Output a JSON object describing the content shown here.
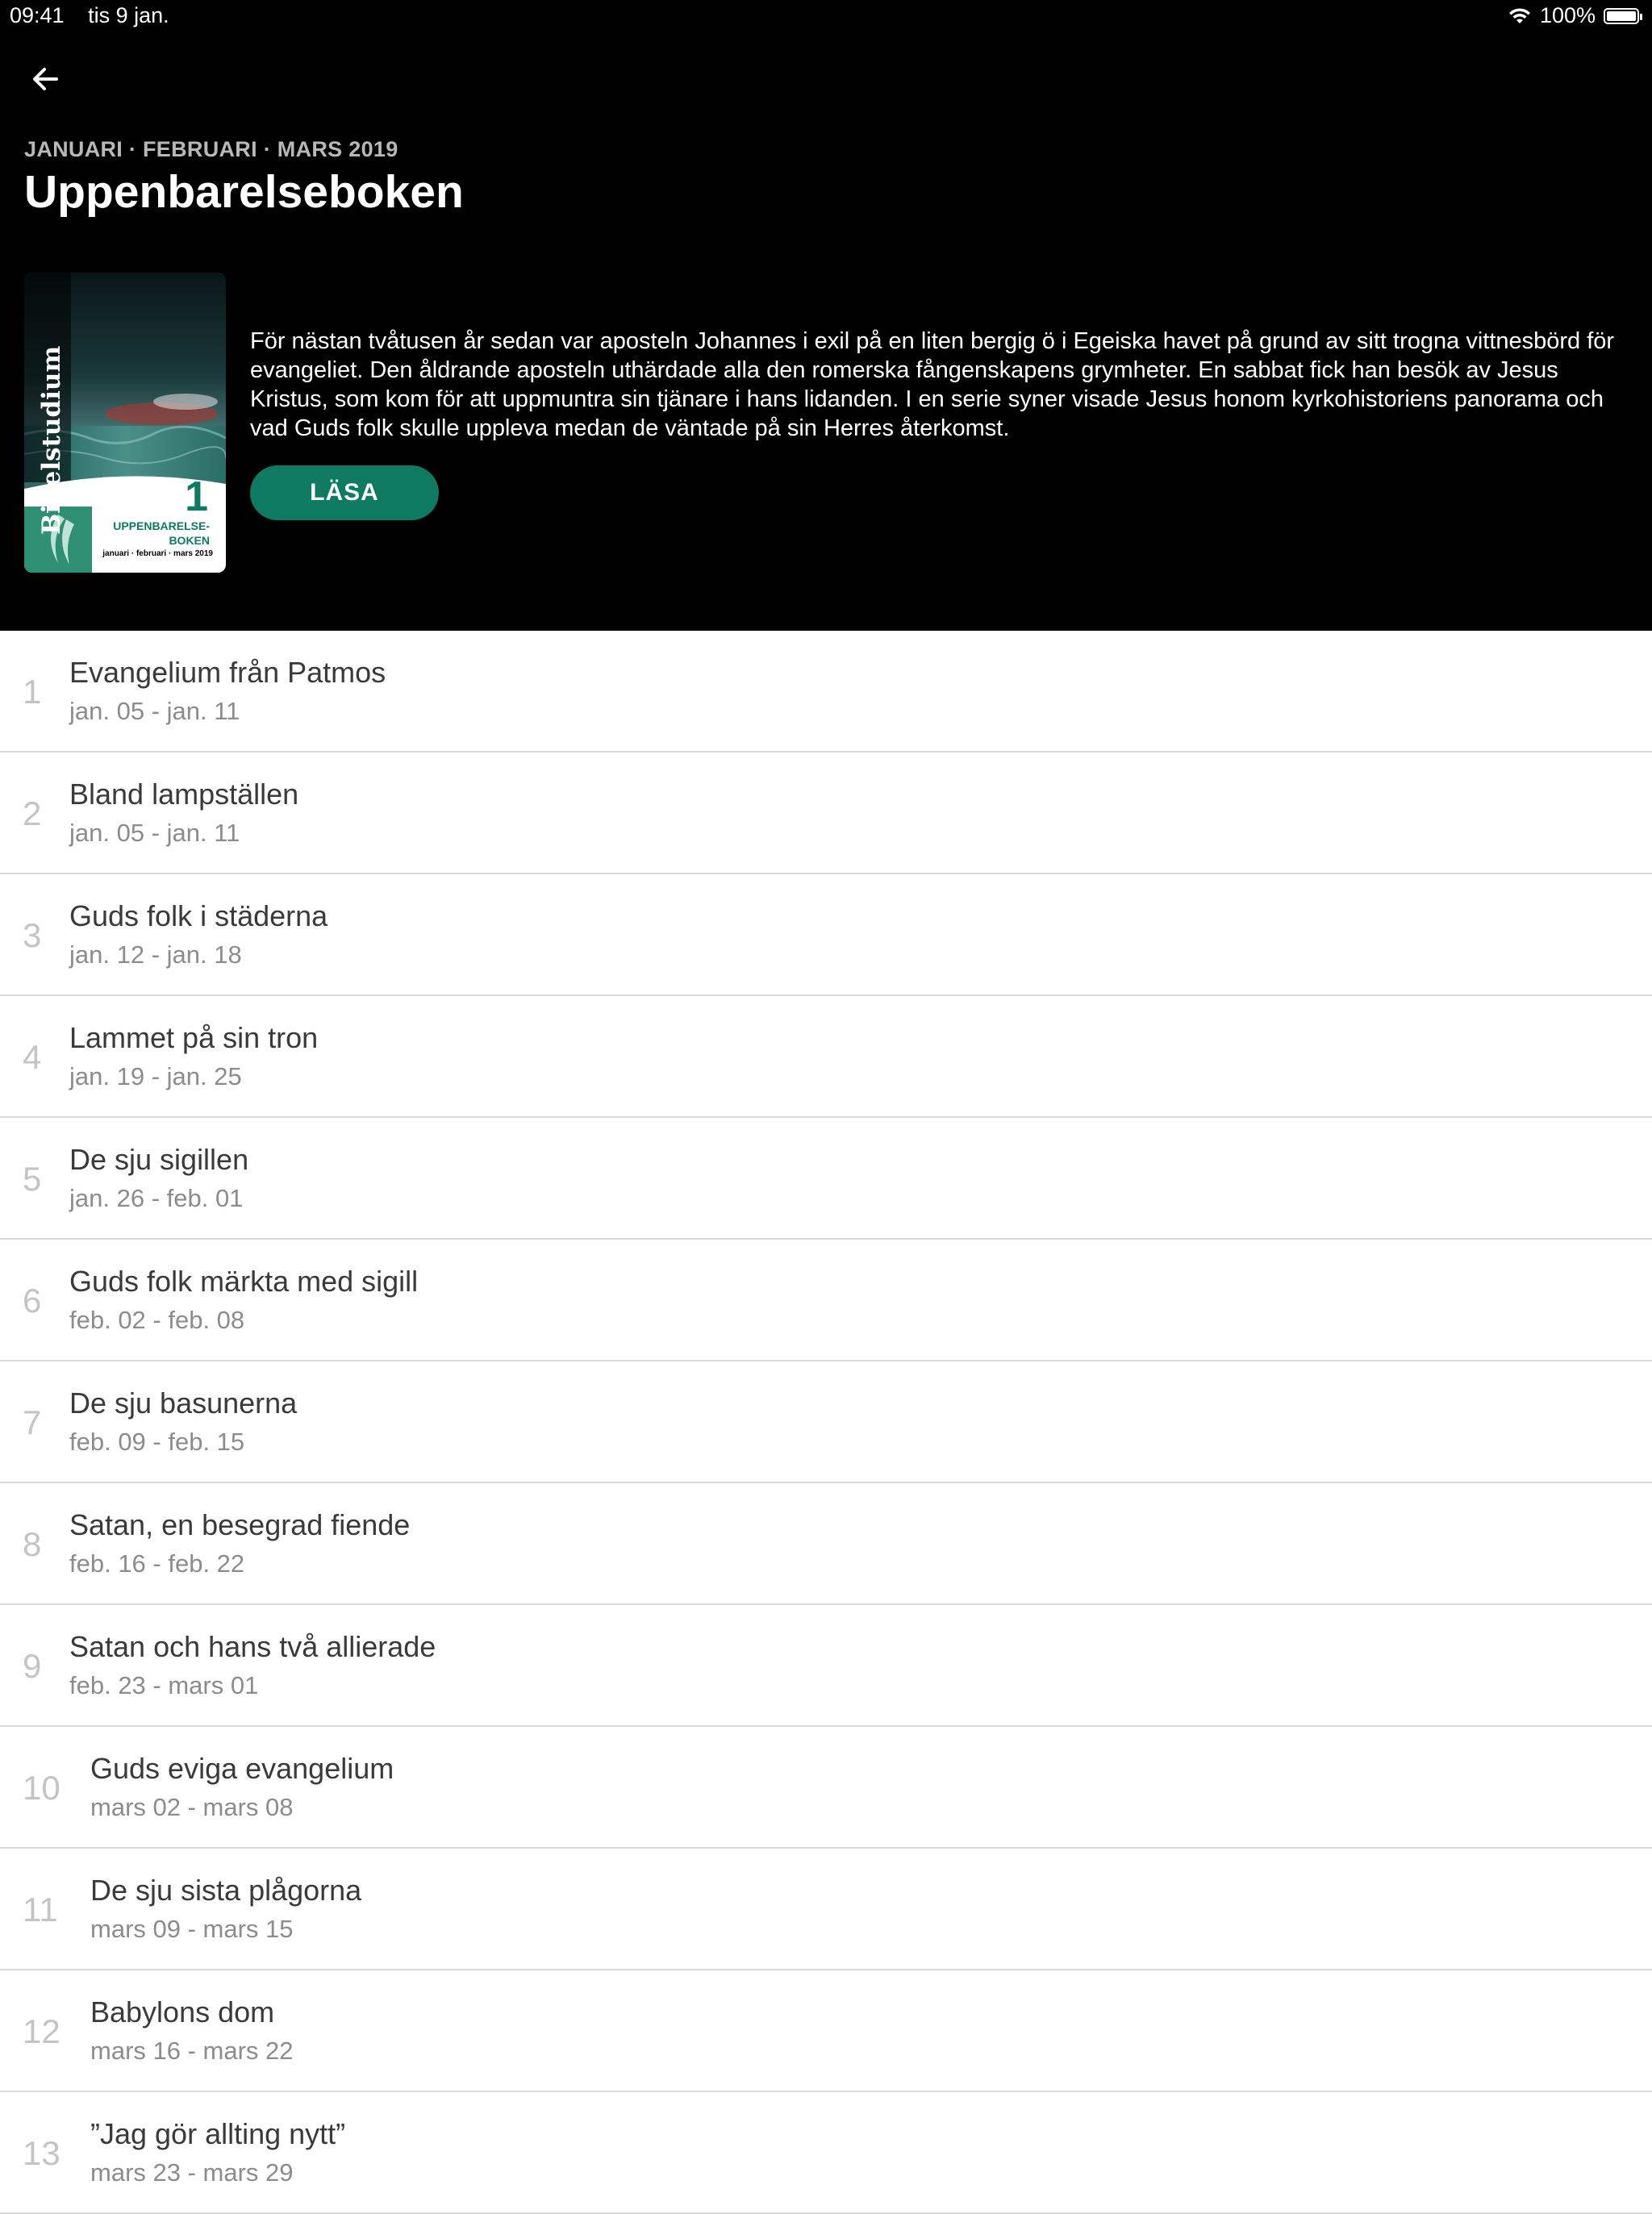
{
  "status_bar": {
    "time": "09:41",
    "date": "tis 9 jan.",
    "battery": "100%",
    "battery_level": 1.0
  },
  "header": {
    "back_icon": "arrow-left-icon",
    "kicker": "JANUARI · FEBRUARI · MARS 2019",
    "title": "Uppenbarelseboken",
    "cover": {
      "spine": "Bibelstudium",
      "number": "1",
      "title": "UPPENBARELSE-BOKEN",
      "dates": "januari · februari · mars 2019"
    },
    "description": "För nästan tvåtusen år sedan var aposteln Johannes i exil på en liten bergig ö i Egeiska havet på grund av sitt trogna vittnesbörd för evangeliet. Den åldrande aposteln uthärdade alla den romerska fångenskapens grymheter. En sabbat fick han besök av Jesus Kristus, som kom för att uppmuntra sin tjänare i hans lidanden. I en serie syner visade Jesus honom kyrkohistoriens panorama och vad Guds folk skulle uppleva medan de väntade på sin Herres återkomst.",
    "read_button": "LÄSA",
    "accent_color": "#0f7a62"
  },
  "lessons": [
    {
      "number": "1",
      "title": "Evangelium från Patmos",
      "dates": "jan. 05 - jan. 11"
    },
    {
      "number": "2",
      "title": "Bland lampställen",
      "dates": "jan. 05 - jan. 11"
    },
    {
      "number": "3",
      "title": "Guds folk i städerna",
      "dates": "jan. 12 - jan. 18"
    },
    {
      "number": "4",
      "title": "Lammet på sin tron",
      "dates": "jan. 19 - jan. 25"
    },
    {
      "number": "5",
      "title": "De sju sigillen",
      "dates": "jan. 26 - feb. 01"
    },
    {
      "number": "6",
      "title": "Guds folk märkta med sigill",
      "dates": "feb. 02 - feb. 08"
    },
    {
      "number": "7",
      "title": "De sju basunerna",
      "dates": "feb. 09 - feb. 15"
    },
    {
      "number": "8",
      "title": "Satan, en besegrad fiende",
      "dates": "feb. 16 - feb. 22"
    },
    {
      "number": "9",
      "title": "Satan och hans två allierade",
      "dates": "feb. 23 - mars 01"
    },
    {
      "number": "10",
      "title": "Guds eviga evangelium",
      "dates": "mars 02 - mars 08"
    },
    {
      "number": "11",
      "title": "De sju sista plågorna",
      "dates": "mars 09 - mars 15"
    },
    {
      "number": "12",
      "title": "Babylons dom",
      "dates": "mars 16 - mars 22"
    },
    {
      "number": "13",
      "title": "”Jag gör allting nytt”",
      "dates": "mars 23 - mars 29"
    }
  ]
}
